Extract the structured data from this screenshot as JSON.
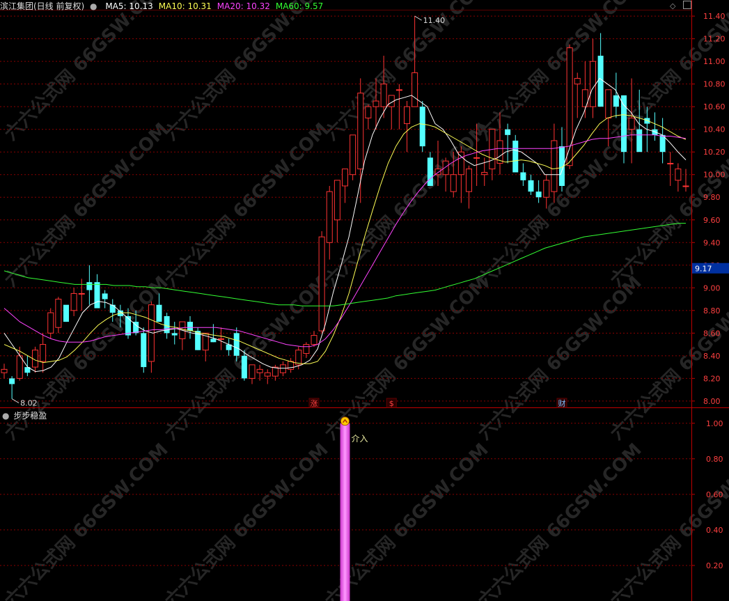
{
  "header": {
    "stock_title": "滨江集团(日线 前复权)",
    "ma_items": [
      {
        "label": "MA5: 10.13",
        "color": "#ffffff"
      },
      {
        "label": "MA10: 10.31",
        "color": "#ffff55"
      },
      {
        "label": "MA20: 10.32",
        "color": "#ff44ff"
      },
      {
        "label": "MA60: 9.57",
        "color": "#33ff33"
      }
    ]
  },
  "sub_panel": {
    "title": "步步稳盈"
  },
  "watermark": "六六公式网 66GSW.COM",
  "colors": {
    "up": "#ff3333",
    "down": "#54ffff",
    "ma5": "#ffffff",
    "ma10": "#ffff55",
    "ma20": "#ff44ff",
    "ma60": "#33ff33",
    "grid": "#8b0000",
    "signal_bar": "#ff66ff"
  },
  "chart_data": [
    {
      "type": "candlestick",
      "title": "滨江集团(日线 前复权)",
      "y_ticks": [
        "11.40",
        "11.20",
        "11.00",
        "10.80",
        "10.60",
        "10.40",
        "10.20",
        "10.00",
        "9.80",
        "9.60",
        "9.40",
        "9.20",
        "9.00",
        "8.80",
        "8.60",
        "8.40",
        "8.20",
        "8.00"
      ],
      "ylim": [
        7.95,
        11.45
      ],
      "current_price_label": "9.17",
      "high_annotation": "11.40",
      "low_annotation": "8.02",
      "event_markers": [
        "涨",
        "$",
        "财"
      ],
      "candles": [
        [
          8.25,
          8.33,
          8.2,
          8.28
        ],
        [
          8.2,
          8.22,
          8.02,
          8.15
        ],
        [
          8.2,
          8.48,
          8.18,
          8.4
        ],
        [
          8.3,
          8.4,
          8.22,
          8.25
        ],
        [
          8.3,
          8.48,
          8.25,
          8.45
        ],
        [
          8.35,
          8.6,
          8.25,
          8.5
        ],
        [
          8.6,
          8.82,
          8.55,
          8.78
        ],
        [
          8.65,
          8.92,
          8.6,
          8.9
        ],
        [
          8.85,
          8.8,
          8.7,
          8.7
        ],
        [
          8.8,
          9.0,
          8.75,
          8.95
        ],
        [
          8.95,
          9.08,
          8.8,
          8.95
        ],
        [
          9.05,
          9.2,
          8.85,
          8.98
        ],
        [
          9.05,
          9.12,
          8.85,
          8.82
        ],
        [
          8.95,
          8.98,
          8.82,
          8.9
        ],
        [
          8.85,
          8.9,
          8.7,
          8.78
        ],
        [
          8.8,
          8.85,
          8.65,
          8.75
        ],
        [
          8.75,
          8.82,
          8.55,
          8.58
        ],
        [
          8.7,
          8.8,
          8.58,
          8.6
        ],
        [
          8.6,
          8.65,
          8.25,
          8.3
        ],
        [
          8.35,
          8.88,
          8.25,
          8.85
        ],
        [
          8.85,
          8.95,
          8.7,
          8.7
        ],
        [
          8.75,
          8.78,
          8.55,
          8.6
        ],
        [
          8.6,
          8.7,
          8.5,
          8.58
        ],
        [
          8.55,
          8.7,
          8.45,
          8.7
        ],
        [
          8.7,
          8.75,
          8.55,
          8.62
        ],
        [
          8.62,
          8.65,
          8.45,
          8.45
        ],
        [
          8.45,
          8.6,
          8.35,
          8.6
        ],
        [
          8.55,
          8.68,
          8.52,
          8.52
        ],
        [
          8.55,
          8.65,
          8.45,
          8.55
        ],
        [
          8.5,
          8.55,
          8.4,
          8.45
        ],
        [
          8.6,
          8.65,
          8.35,
          8.4
        ],
        [
          8.4,
          8.45,
          8.18,
          8.2
        ],
        [
          8.2,
          8.32,
          8.15,
          8.32
        ],
        [
          8.25,
          8.32,
          8.18,
          8.28
        ],
        [
          8.22,
          8.28,
          8.15,
          8.25
        ],
        [
          8.22,
          8.32,
          8.18,
          8.3
        ],
        [
          8.25,
          8.35,
          8.22,
          8.32
        ],
        [
          8.28,
          8.38,
          8.25,
          8.35
        ],
        [
          8.32,
          8.48,
          8.28,
          8.45
        ],
        [
          8.42,
          8.52,
          8.38,
          8.5
        ],
        [
          8.5,
          8.62,
          8.48,
          8.58
        ],
        [
          8.62,
          9.5,
          8.6,
          9.45
        ],
        [
          9.4,
          9.9,
          9.25,
          9.85
        ],
        [
          9.6,
          9.95,
          9.4,
          9.95
        ],
        [
          9.9,
          10.05,
          9.75,
          10.05
        ],
        [
          10.0,
          10.35,
          9.95,
          10.35
        ],
        [
          10.05,
          10.85,
          9.75,
          10.72
        ],
        [
          10.5,
          10.62,
          10.4,
          10.6
        ],
        [
          10.6,
          10.85,
          10.4,
          10.65
        ],
        [
          10.6,
          11.05,
          10.5,
          10.8
        ],
        [
          10.6,
          10.7,
          10.4,
          10.7
        ],
        [
          10.75,
          10.8,
          10.4,
          10.75
        ],
        [
          10.45,
          10.65,
          10.2,
          10.6
        ],
        [
          10.6,
          11.4,
          10.6,
          10.9
        ],
        [
          10.6,
          10.65,
          10.2,
          10.25
        ],
        [
          10.15,
          10.2,
          9.9,
          9.9
        ],
        [
          10.0,
          10.3,
          9.9,
          10.05
        ],
        [
          10.0,
          10.15,
          9.85,
          10.12
        ],
        [
          9.85,
          10.2,
          9.8,
          10.0
        ],
        [
          10.0,
          10.25,
          9.75,
          10.2
        ],
        [
          9.85,
          10.08,
          9.7,
          10.05
        ],
        [
          10.15,
          10.45,
          9.9,
          10.15
        ],
        [
          10.0,
          10.15,
          9.9,
          10.02
        ],
        [
          10.05,
          10.4,
          9.95,
          10.4
        ],
        [
          10.1,
          10.55,
          10.0,
          10.3
        ],
        [
          10.4,
          10.45,
          10.1,
          10.35
        ],
        [
          10.3,
          10.35,
          10.02,
          10.02
        ],
        [
          10.02,
          10.1,
          9.9,
          9.95
        ],
        [
          9.95,
          10.0,
          9.82,
          9.85
        ],
        [
          9.85,
          9.95,
          9.75,
          9.8
        ],
        [
          9.8,
          10.0,
          9.7,
          9.95
        ],
        [
          9.85,
          10.45,
          9.75,
          10.3
        ],
        [
          10.25,
          10.42,
          9.85,
          9.9
        ],
        [
          10.08,
          11.15,
          10.05,
          11.12
        ],
        [
          10.8,
          10.9,
          10.5,
          10.85
        ],
        [
          10.6,
          11.0,
          10.5,
          10.75
        ],
        [
          10.6,
          11.2,
          10.5,
          11.0
        ],
        [
          11.05,
          11.25,
          10.6,
          10.6
        ],
        [
          10.5,
          10.75,
          10.25,
          10.75
        ],
        [
          10.7,
          10.9,
          10.5,
          10.6
        ],
        [
          10.7,
          10.7,
          10.1,
          10.2
        ],
        [
          10.4,
          10.85,
          10.1,
          10.5
        ],
        [
          10.4,
          10.75,
          10.3,
          10.2
        ],
        [
          10.5,
          10.6,
          10.2,
          10.45
        ],
        [
          10.4,
          10.55,
          10.3,
          10.35
        ],
        [
          10.35,
          10.5,
          10.1,
          10.2
        ],
        [
          10.1,
          10.2,
          9.9,
          10.1
        ],
        [
          9.95,
          10.1,
          9.85,
          10.05
        ],
        [
          9.9,
          10.05,
          9.85,
          9.9
        ]
      ],
      "series": [
        {
          "name": "MA5",
          "values": [
            8.6,
            8.5,
            8.4,
            8.3,
            8.26,
            8.27,
            8.3,
            8.38,
            8.52,
            8.65,
            8.78,
            8.85,
            8.88,
            8.87,
            8.84,
            8.78,
            8.72,
            8.66,
            8.62,
            8.6,
            8.62,
            8.63,
            8.64,
            8.62,
            8.6,
            8.59,
            8.57,
            8.55,
            8.52,
            8.49,
            8.46,
            8.41,
            8.37,
            8.33,
            8.3,
            8.29,
            8.29,
            8.3,
            8.32,
            8.36,
            8.46,
            8.68,
            8.96,
            9.2,
            9.45,
            9.78,
            10.12,
            10.35,
            10.5,
            10.62,
            10.66,
            10.68,
            10.7,
            10.65,
            10.6,
            10.45,
            10.4,
            10.3,
            10.18,
            10.12,
            10.08,
            10.1,
            10.12,
            10.15,
            10.2,
            10.22,
            10.2,
            10.15,
            10.1,
            10.0,
            10.0,
            10.0,
            10.2,
            10.4,
            10.55,
            10.75,
            10.85,
            10.8,
            10.75,
            10.62,
            10.55,
            10.45,
            10.4,
            10.38,
            10.35,
            10.28,
            10.2,
            10.13
          ]
        },
        {
          "name": "MA10",
          "values": [
            8.5,
            8.47,
            8.44,
            8.4,
            8.36,
            8.34,
            8.35,
            8.36,
            8.39,
            8.45,
            8.52,
            8.6,
            8.67,
            8.72,
            8.76,
            8.78,
            8.78,
            8.76,
            8.74,
            8.71,
            8.68,
            8.66,
            8.65,
            8.63,
            8.62,
            8.6,
            8.59,
            8.58,
            8.57,
            8.55,
            8.53,
            8.5,
            8.47,
            8.44,
            8.41,
            8.38,
            8.36,
            8.34,
            8.33,
            8.33,
            8.35,
            8.44,
            8.58,
            8.75,
            8.95,
            9.2,
            9.45,
            9.68,
            9.9,
            10.1,
            10.25,
            10.36,
            10.42,
            10.45,
            10.44,
            10.42,
            10.38,
            10.34,
            10.3,
            10.26,
            10.22,
            10.18,
            10.15,
            10.13,
            10.11,
            10.12,
            10.13,
            10.12,
            10.1,
            10.08,
            10.05,
            10.06,
            10.1,
            10.18,
            10.26,
            10.36,
            10.45,
            10.5,
            10.52,
            10.53,
            10.52,
            10.5,
            10.48,
            10.45,
            10.42,
            10.38,
            10.34,
            10.31
          ]
        },
        {
          "name": "MA20",
          "values": [
            8.82,
            8.76,
            8.7,
            8.66,
            8.62,
            8.58,
            8.55,
            8.53,
            8.52,
            8.52,
            8.52,
            8.53,
            8.55,
            8.57,
            8.58,
            8.59,
            8.6,
            8.61,
            8.62,
            8.63,
            8.63,
            8.64,
            8.64,
            8.65,
            8.65,
            8.65,
            8.65,
            8.65,
            8.64,
            8.63,
            8.62,
            8.6,
            8.58,
            8.56,
            8.54,
            8.52,
            8.5,
            8.49,
            8.48,
            8.48,
            8.5,
            8.55,
            8.63,
            8.73,
            8.84,
            8.96,
            9.08,
            9.2,
            9.32,
            9.44,
            9.56,
            9.67,
            9.77,
            9.86,
            9.94,
            10.0,
            10.05,
            10.1,
            10.14,
            10.17,
            10.19,
            10.21,
            10.22,
            10.23,
            10.23,
            10.23,
            10.23,
            10.23,
            10.23,
            10.23,
            10.23,
            10.24,
            10.25,
            10.27,
            10.29,
            10.31,
            10.32,
            10.32,
            10.33,
            10.34,
            10.35,
            10.35,
            10.35,
            10.35,
            10.34,
            10.34,
            10.33,
            10.32
          ]
        },
        {
          "name": "MA60",
          "values": [
            9.15,
            9.13,
            9.11,
            9.09,
            9.08,
            9.07,
            9.06,
            9.05,
            9.04,
            9.03,
            9.03,
            9.03,
            9.03,
            9.03,
            9.02,
            9.02,
            9.02,
            9.01,
            9.01,
            9.0,
            9.0,
            8.99,
            8.98,
            8.97,
            8.96,
            8.95,
            8.94,
            8.93,
            8.92,
            8.91,
            8.9,
            8.89,
            8.88,
            8.87,
            8.86,
            8.85,
            8.85,
            8.85,
            8.84,
            8.84,
            8.84,
            8.84,
            8.84,
            8.85,
            8.86,
            8.87,
            8.88,
            8.89,
            8.9,
            8.91,
            8.93,
            8.94,
            8.95,
            8.96,
            8.97,
            8.98,
            9.0,
            9.02,
            9.04,
            9.06,
            9.08,
            9.11,
            9.14,
            9.17,
            9.2,
            9.23,
            9.26,
            9.29,
            9.32,
            9.35,
            9.37,
            9.39,
            9.41,
            9.43,
            9.45,
            9.46,
            9.47,
            9.48,
            9.49,
            9.5,
            9.51,
            9.52,
            9.53,
            9.54,
            9.55,
            9.56,
            9.57,
            9.57
          ]
        }
      ]
    },
    {
      "type": "bar",
      "title": "步步稳盈",
      "y_ticks": [
        "1.00",
        "0.80",
        "0.60",
        "0.40",
        "0.20"
      ],
      "ylim": [
        0,
        1.05
      ],
      "signal": {
        "index": 44,
        "value": 1.0,
        "label": "介入"
      }
    }
  ]
}
